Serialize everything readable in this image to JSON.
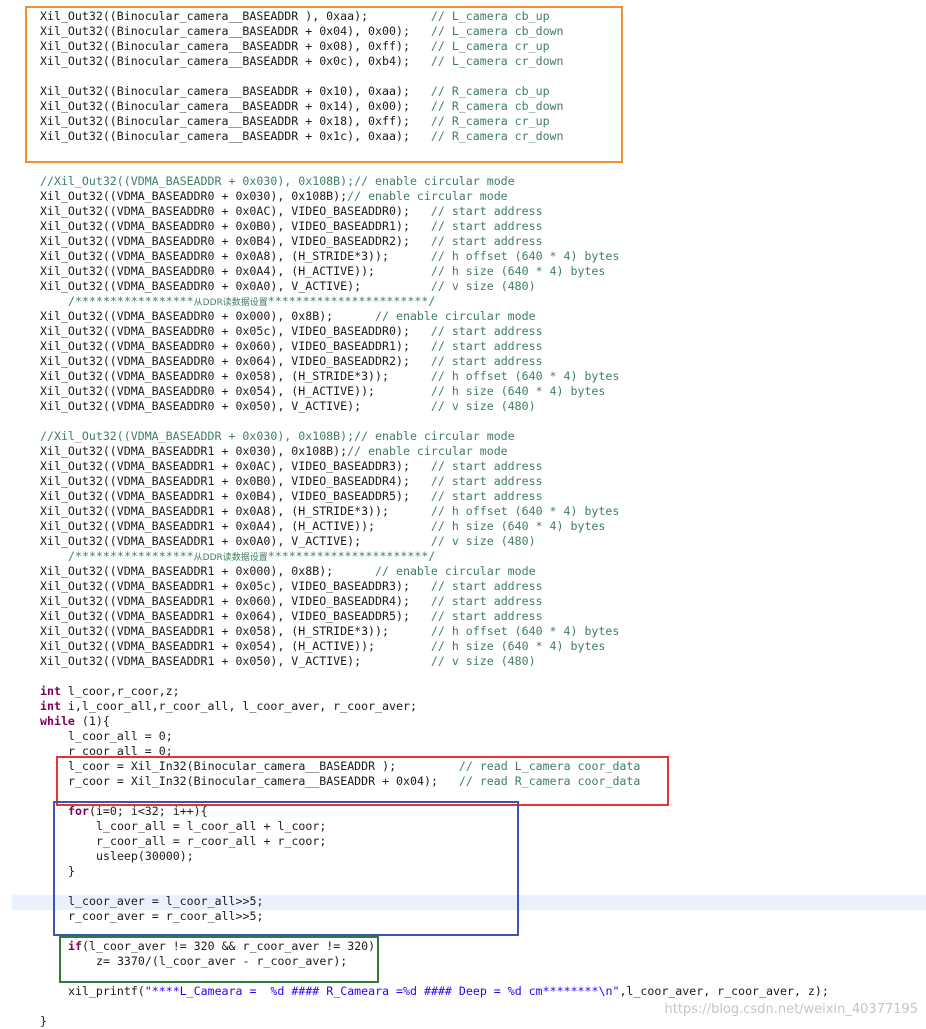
{
  "colors": {
    "orange_box": "#f0913a",
    "red_box": "#e8332e",
    "blue_box": "#3a55b5",
    "green_box": "#2e7d32",
    "keyword": "#7f0055",
    "comment": "#3f7f5f",
    "string": "#2a00ff",
    "text": "#1a1a1a",
    "current_line": "#e8f2fe"
  },
  "code": {
    "lines": [
      {
        "t": 9,
        "i": 0,
        "segs": [
          [
            "Xil_Out32((Binocular_camera__BASEADDR ), 0xaa);         "
          ],
          [
            "// L_camera cb_up",
            "cm"
          ]
        ]
      },
      {
        "t": 24,
        "i": 0,
        "segs": [
          [
            "Xil_Out32((Binocular_camera__BASEADDR + 0x04), 0x00);   "
          ],
          [
            "// L_camera cb_down",
            "cm"
          ]
        ]
      },
      {
        "t": 39,
        "i": 0,
        "segs": [
          [
            "Xil_Out32((Binocular_camera__BASEADDR + 0x08), 0xff);   "
          ],
          [
            "// L_camera cr_up",
            "cm"
          ]
        ]
      },
      {
        "t": 54,
        "i": 0,
        "segs": [
          [
            "Xil_Out32((Binocular_camera__BASEADDR + 0x0c), 0xb4);   "
          ],
          [
            "// L_camera cr_down",
            "cm"
          ]
        ]
      },
      {
        "t": 84,
        "i": 0,
        "segs": [
          [
            "Xil_Out32((Binocular_camera__BASEADDR + 0x10), 0xaa);   "
          ],
          [
            "// R_camera cb_up",
            "cm"
          ]
        ]
      },
      {
        "t": 99,
        "i": 0,
        "segs": [
          [
            "Xil_Out32((Binocular_camera__BASEADDR + 0x14), 0x00);   "
          ],
          [
            "// R_camera cb_down",
            "cm"
          ]
        ]
      },
      {
        "t": 114,
        "i": 0,
        "segs": [
          [
            "Xil_Out32((Binocular_camera__BASEADDR + 0x18), 0xff);   "
          ],
          [
            "// R_camera cr_up",
            "cm"
          ]
        ]
      },
      {
        "t": 129,
        "i": 0,
        "segs": [
          [
            "Xil_Out32((Binocular_camera__BASEADDR + 0x1c), 0xaa);   "
          ],
          [
            "// R_camera cr_down",
            "cm"
          ]
        ]
      },
      {
        "t": 174,
        "i": 0,
        "segs": [
          [
            "//Xil_Out32((VDMA_BASEADDR + 0x030), 0x108B);// enable circular mode",
            "cm"
          ]
        ]
      },
      {
        "t": 189,
        "i": 0,
        "segs": [
          [
            "Xil_Out32((VDMA_BASEADDR0 + 0x030), 0x108B);"
          ],
          [
            "// enable circular mode",
            "cm"
          ]
        ]
      },
      {
        "t": 204,
        "i": 0,
        "segs": [
          [
            "Xil_Out32((VDMA_BASEADDR0 + 0x0AC), VIDEO_BASEADDR0);   "
          ],
          [
            "// start address",
            "cm"
          ]
        ]
      },
      {
        "t": 219,
        "i": 0,
        "segs": [
          [
            "Xil_Out32((VDMA_BASEADDR0 + 0x0B0), VIDEO_BASEADDR1);   "
          ],
          [
            "// start address",
            "cm"
          ]
        ]
      },
      {
        "t": 234,
        "i": 0,
        "segs": [
          [
            "Xil_Out32((VDMA_BASEADDR0 + 0x0B4), VIDEO_BASEADDR2);   "
          ],
          [
            "// start address",
            "cm"
          ]
        ]
      },
      {
        "t": 249,
        "i": 0,
        "segs": [
          [
            "Xil_Out32((VDMA_BASEADDR0 + 0x0A8), (H_STRIDE*3));      "
          ],
          [
            "// h offset (640 * 4) bytes",
            "cm"
          ]
        ]
      },
      {
        "t": 264,
        "i": 0,
        "segs": [
          [
            "Xil_Out32((VDMA_BASEADDR0 + 0x0A4), (H_ACTIVE));        "
          ],
          [
            "// h size (640 * 4) bytes",
            "cm"
          ]
        ]
      },
      {
        "t": 279,
        "i": 0,
        "segs": [
          [
            "Xil_Out32((VDMA_BASEADDR0 + 0x0A0), V_ACTIVE);          "
          ],
          [
            "// v size (480)",
            "cm"
          ]
        ]
      },
      {
        "t": 294,
        "i": 4,
        "segs": [
          [
            "/*****************",
            "cm"
          ],
          [
            "从DDR读数据设置",
            "cm cn"
          ],
          [
            "***********************/",
            "cm"
          ]
        ]
      },
      {
        "t": 309,
        "i": 0,
        "segs": [
          [
            "Xil_Out32((VDMA_BASEADDR0 + 0x000), 0x8B);      "
          ],
          [
            "// enable circular mode",
            "cm"
          ]
        ]
      },
      {
        "t": 324,
        "i": 0,
        "segs": [
          [
            "Xil_Out32((VDMA_BASEADDR0 + 0x05c), VIDEO_BASEADDR0);   "
          ],
          [
            "// start address",
            "cm"
          ]
        ]
      },
      {
        "t": 339,
        "i": 0,
        "segs": [
          [
            "Xil_Out32((VDMA_BASEADDR0 + 0x060), VIDEO_BASEADDR1);   "
          ],
          [
            "// start address",
            "cm"
          ]
        ]
      },
      {
        "t": 354,
        "i": 0,
        "segs": [
          [
            "Xil_Out32((VDMA_BASEADDR0 + 0x064), VIDEO_BASEADDR2);   "
          ],
          [
            "// start address",
            "cm"
          ]
        ]
      },
      {
        "t": 369,
        "i": 0,
        "segs": [
          [
            "Xil_Out32((VDMA_BASEADDR0 + 0x058), (H_STRIDE*3));      "
          ],
          [
            "// h offset (640 * 4) bytes",
            "cm"
          ]
        ]
      },
      {
        "t": 384,
        "i": 0,
        "segs": [
          [
            "Xil_Out32((VDMA_BASEADDR0 + 0x054), (H_ACTIVE));        "
          ],
          [
            "// h size (640 * 4) bytes",
            "cm"
          ]
        ]
      },
      {
        "t": 399,
        "i": 0,
        "segs": [
          [
            "Xil_Out32((VDMA_BASEADDR0 + 0x050), V_ACTIVE);          "
          ],
          [
            "// v size (480)",
            "cm"
          ]
        ]
      },
      {
        "t": 429,
        "i": 0,
        "segs": [
          [
            "//Xil_Out32((VDMA_BASEADDR + 0x030), 0x108B);// enable circular mode",
            "cm"
          ]
        ]
      },
      {
        "t": 444,
        "i": 0,
        "segs": [
          [
            "Xil_Out32((VDMA_BASEADDR1 + 0x030), 0x108B);"
          ],
          [
            "// enable circular mode",
            "cm"
          ]
        ]
      },
      {
        "t": 459,
        "i": 0,
        "segs": [
          [
            "Xil_Out32((VDMA_BASEADDR1 + 0x0AC), VIDEO_BASEADDR3);   "
          ],
          [
            "// start address",
            "cm"
          ]
        ]
      },
      {
        "t": 474,
        "i": 0,
        "segs": [
          [
            "Xil_Out32((VDMA_BASEADDR1 + 0x0B0), VIDEO_BASEADDR4);   "
          ],
          [
            "// start address",
            "cm"
          ]
        ]
      },
      {
        "t": 489,
        "i": 0,
        "segs": [
          [
            "Xil_Out32((VDMA_BASEADDR1 + 0x0B4), VIDEO_BASEADDR5);   "
          ],
          [
            "// start address",
            "cm"
          ]
        ]
      },
      {
        "t": 504,
        "i": 0,
        "segs": [
          [
            "Xil_Out32((VDMA_BASEADDR1 + 0x0A8), (H_STRIDE*3));      "
          ],
          [
            "// h offset (640 * 4) bytes",
            "cm"
          ]
        ]
      },
      {
        "t": 519,
        "i": 0,
        "segs": [
          [
            "Xil_Out32((VDMA_BASEADDR1 + 0x0A4), (H_ACTIVE));        "
          ],
          [
            "// h size (640 * 4) bytes",
            "cm"
          ]
        ]
      },
      {
        "t": 534,
        "i": 0,
        "segs": [
          [
            "Xil_Out32((VDMA_BASEADDR1 + 0x0A0), V_ACTIVE);          "
          ],
          [
            "// v size (480)",
            "cm"
          ]
        ]
      },
      {
        "t": 549,
        "i": 4,
        "segs": [
          [
            "/*****************",
            "cm"
          ],
          [
            "从DDR读数据设置",
            "cm cn"
          ],
          [
            "***********************/",
            "cm"
          ]
        ]
      },
      {
        "t": 564,
        "i": 0,
        "segs": [
          [
            "Xil_Out32((VDMA_BASEADDR1 + 0x000), 0x8B);      "
          ],
          [
            "// enable circular mode",
            "cm"
          ]
        ]
      },
      {
        "t": 579,
        "i": 0,
        "segs": [
          [
            "Xil_Out32((VDMA_BASEADDR1 + 0x05c), VIDEO_BASEADDR3);   "
          ],
          [
            "// start address",
            "cm"
          ]
        ]
      },
      {
        "t": 594,
        "i": 0,
        "segs": [
          [
            "Xil_Out32((VDMA_BASEADDR1 + 0x060), VIDEO_BASEADDR4);   "
          ],
          [
            "// start address",
            "cm"
          ]
        ]
      },
      {
        "t": 609,
        "i": 0,
        "segs": [
          [
            "Xil_Out32((VDMA_BASEADDR1 + 0x064), VIDEO_BASEADDR5);   "
          ],
          [
            "// start address",
            "cm"
          ]
        ]
      },
      {
        "t": 624,
        "i": 0,
        "segs": [
          [
            "Xil_Out32((VDMA_BASEADDR1 + 0x058), (H_STRIDE*3));      "
          ],
          [
            "// h offset (640 * 4) bytes",
            "cm"
          ]
        ]
      },
      {
        "t": 639,
        "i": 0,
        "segs": [
          [
            "Xil_Out32((VDMA_BASEADDR1 + 0x054), (H_ACTIVE));        "
          ],
          [
            "// h size (640 * 4) bytes",
            "cm"
          ]
        ]
      },
      {
        "t": 654,
        "i": 0,
        "segs": [
          [
            "Xil_Out32((VDMA_BASEADDR1 + 0x050), V_ACTIVE);          "
          ],
          [
            "// v size (480)",
            "cm"
          ]
        ]
      },
      {
        "t": 684,
        "i": 0,
        "segs": [
          [
            "int",
            "kw"
          ],
          [
            " l_coor,r_coor,z;"
          ]
        ]
      },
      {
        "t": 699,
        "i": 0,
        "segs": [
          [
            "int",
            "kw"
          ],
          [
            " i,l_coor_all,r_coor_all, l_coor_aver, r_coor_aver;"
          ]
        ]
      },
      {
        "t": 714,
        "i": 0,
        "segs": [
          [
            "while",
            "kw"
          ],
          [
            " (1){"
          ]
        ]
      },
      {
        "t": 729,
        "i": 4,
        "segs": [
          [
            "l_coor_all = 0;"
          ]
        ]
      },
      {
        "t": 744,
        "i": 4,
        "segs": [
          [
            "r_coor_all = 0;"
          ]
        ]
      },
      {
        "t": 759,
        "i": 4,
        "segs": [
          [
            "l_coor = Xil_In32(Binocular_camera__BASEADDR );         "
          ],
          [
            "// read L_camera coor_data",
            "cm"
          ]
        ]
      },
      {
        "t": 774,
        "i": 4,
        "segs": [
          [
            "r_coor = Xil_In32(Binocular_camera__BASEADDR + 0x04);   "
          ],
          [
            "// read R_camera coor_data",
            "cm"
          ]
        ]
      },
      {
        "t": 804,
        "i": 4,
        "segs": [
          [
            "for",
            "kw"
          ],
          [
            "(i=0; i<32; i++){"
          ]
        ]
      },
      {
        "t": 819,
        "i": 8,
        "segs": [
          [
            "l_coor_all = l_coor_all + l_coor;"
          ]
        ]
      },
      {
        "t": 834,
        "i": 8,
        "segs": [
          [
            "r_coor_all = r_coor_all + r_coor;"
          ]
        ]
      },
      {
        "t": 849,
        "i": 8,
        "segs": [
          [
            "usleep(30000);"
          ]
        ]
      },
      {
        "t": 864,
        "i": 4,
        "segs": [
          [
            "}"
          ]
        ]
      },
      {
        "t": 894,
        "i": 4,
        "segs": [
          [
            "l_coor_aver = l_coor_all>>5;"
          ]
        ]
      },
      {
        "t": 909,
        "i": 4,
        "segs": [
          [
            "r_coor_aver = r_coor_all>>5;"
          ]
        ]
      },
      {
        "t": 939,
        "i": 4,
        "segs": [
          [
            "if",
            "kw"
          ],
          [
            "(l_coor_aver != 320 && r_coor_aver != 320)"
          ]
        ]
      },
      {
        "t": 954,
        "i": 8,
        "segs": [
          [
            "z= 3370/(l_coor_aver - r_coor_aver);"
          ]
        ]
      },
      {
        "t": 984,
        "i": 4,
        "segs": [
          [
            "xil_printf("
          ],
          [
            "\"****L_Cameara =  %d #### R_Cameara =%d #### Deep = %d cm********\\n\"",
            "st"
          ],
          [
            ",l_coor_aver, r_coor_aver, z);"
          ]
        ]
      },
      {
        "t": 1014,
        "i": 0,
        "segs": [
          [
            "}"
          ]
        ]
      }
    ]
  },
  "watermark": {
    "text": "https://blog.csdn.net/weixin_40377195"
  }
}
